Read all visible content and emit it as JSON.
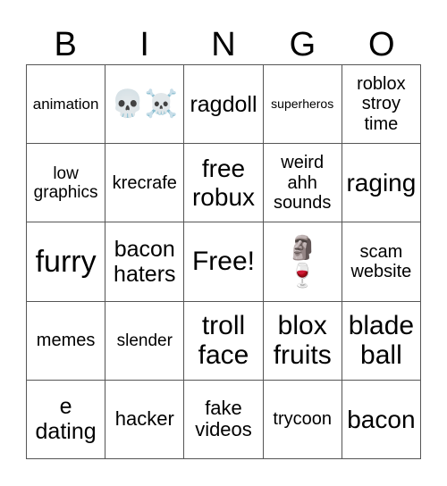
{
  "header": [
    "B",
    "I",
    "N",
    "G",
    "O"
  ],
  "cells": [
    {
      "text": "animation",
      "kind": "text"
    },
    {
      "text": "💀☠️",
      "kind": "emoji",
      "icons": [
        "skull-icon",
        "skull-crossbones-icon"
      ]
    },
    {
      "text": "ragdoll",
      "kind": "text"
    },
    {
      "text": "superheros",
      "kind": "text"
    },
    {
      "text": "roblox\nstroy\ntime",
      "kind": "text"
    },
    {
      "text": "low\ngraphics",
      "kind": "text"
    },
    {
      "text": "krecrafe",
      "kind": "text"
    },
    {
      "text": "free\nrobux",
      "kind": "text"
    },
    {
      "text": "weird\nahh\nsounds",
      "kind": "text"
    },
    {
      "text": "raging",
      "kind": "text"
    },
    {
      "text": "furry",
      "kind": "text"
    },
    {
      "text": "bacon\nhaters",
      "kind": "text"
    },
    {
      "text": "Free!",
      "kind": "free"
    },
    {
      "text": "🗿\n🍷",
      "kind": "emoji",
      "icons": [
        "moai-icon",
        "wine-glass-icon"
      ]
    },
    {
      "text": "scam\nwebsite",
      "kind": "text"
    },
    {
      "text": "memes",
      "kind": "text"
    },
    {
      "text": "slender",
      "kind": "text"
    },
    {
      "text": "troll\nface",
      "kind": "text"
    },
    {
      "text": "blox\nfruits",
      "kind": "text"
    },
    {
      "text": "blade\nball",
      "kind": "text"
    },
    {
      "text": "e\ndating",
      "kind": "text"
    },
    {
      "text": "hacker",
      "kind": "text"
    },
    {
      "text": "fake\nvideos",
      "kind": "text"
    },
    {
      "text": "trycoon",
      "kind": "text"
    },
    {
      "text": "bacon",
      "kind": "text"
    }
  ]
}
